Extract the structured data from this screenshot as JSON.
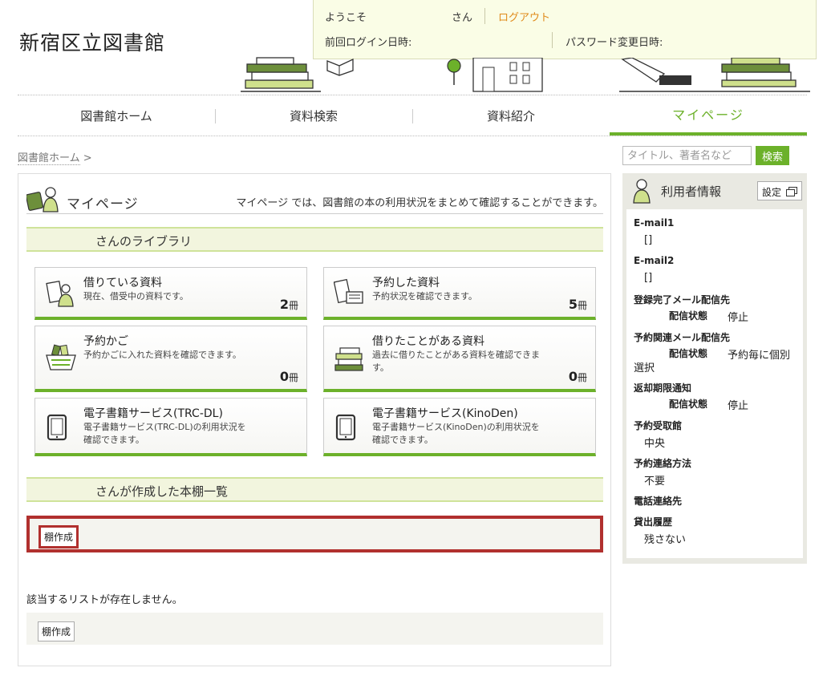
{
  "site": {
    "title": "新宿区立図書館"
  },
  "login": {
    "welcome": "ようこそ",
    "san": "さん",
    "logout": "ログアウト",
    "last_login": "前回ログイン日時:",
    "pw_changed": "パスワード変更日時:"
  },
  "nav": [
    {
      "label": "図書館ホーム"
    },
    {
      "label": "資料検索"
    },
    {
      "label": "資料紹介"
    },
    {
      "label": "マイページ",
      "active": true
    }
  ],
  "breadcrumb": {
    "home": "図書館ホーム",
    "sep": ">"
  },
  "search": {
    "placeholder": "タイトル、著者名など",
    "button": "検索"
  },
  "mypage": {
    "title": "マイページ",
    "description": "マイページ では、図書館の本の利用状況をまとめて確認することができます。",
    "library_header": "さんのライブラリ",
    "cards": [
      {
        "title": "借りている資料",
        "desc": "現在、借受中の資料です。",
        "count": "2",
        "unit": "冊",
        "icon": "person-book-icon"
      },
      {
        "title": "予約した資料",
        "desc": "予約状況を確認できます。",
        "count": "5",
        "unit": "冊",
        "icon": "reserved-book-icon"
      },
      {
        "title": "予約かご",
        "desc": "予約かごに入れた資料を確認できます。",
        "count": "0",
        "unit": "冊",
        "icon": "basket-icon"
      },
      {
        "title": "借りたことがある資料",
        "desc": "過去に借りたことがある資料を確認できます。",
        "count": "0",
        "unit": "冊",
        "icon": "book-stack-icon"
      },
      {
        "title": "電子書籍サービス(TRC-DL)",
        "desc": "電子書籍サービス(TRC-DL)の利用状況を確認できます。",
        "icon": "tablet-icon"
      },
      {
        "title": "電子書籍サービス(KinoDen)",
        "desc": "電子書籍サービス(KinoDen)の利用状況を確認できます。",
        "icon": "tablet-icon"
      }
    ],
    "shelf_header": "さんが作成した本棚一覧",
    "shelf_create": "棚作成",
    "empty_message": "該当するリストが存在しません。"
  },
  "userinfo": {
    "title": "利用者情報",
    "settings": "設定",
    "email1_label": "E-mail1",
    "email1_value": "[]",
    "email2_label": "E-mail2",
    "email2_value": "[]",
    "reg_mail_label": "登録完了メール配信先",
    "reg_mail_status_label": "配信状態",
    "reg_mail_status": "停止",
    "rsv_mail_label": "予約関連メール配信先",
    "rsv_mail_status_label": "配信状態",
    "rsv_mail_status_a": "予約毎に個別",
    "rsv_mail_status_b": "選択",
    "due_label": "返却期限通知",
    "due_status_label": "配信状態",
    "due_status": "停止",
    "pickup_label": "予約受取館",
    "pickup_value": "中央",
    "contact_label": "予約連絡方法",
    "contact_value": "不要",
    "phone_label": "電話連絡先",
    "history_label": "貸出履歴",
    "history_value": "残さない"
  },
  "colors": {
    "accent": "#6cb12a",
    "highlight": "#b1302e",
    "logout": "#e08a1a"
  }
}
